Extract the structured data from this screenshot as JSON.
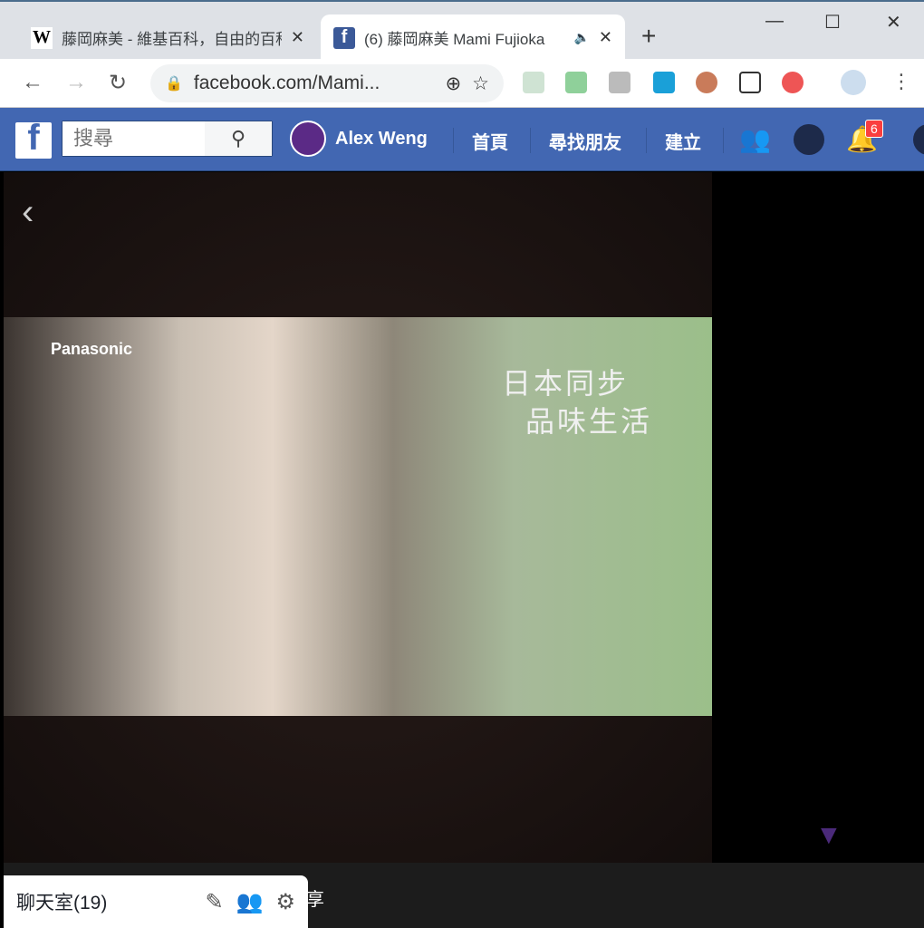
{
  "browser": {
    "tabs": [
      {
        "label": "藤岡麻美 - 維基百科，自由的百科全書",
        "icon": "wikipedia-icon"
      },
      {
        "label": "(6) 藤岡麻美 Mami Fujioka",
        "icon": "facebook-icon",
        "audio": true
      }
    ],
    "url": "facebook.com/Mami...",
    "window_controls": [
      "minimize",
      "maximize",
      "close"
    ]
  },
  "facebook": {
    "search_placeholder": "搜尋",
    "user": "Alex Weng",
    "nav": [
      "首頁",
      "尋找朋友",
      "建立"
    ],
    "notification_count": "6",
    "brand_color": "#4267b2"
  },
  "video": {
    "brand": "Panasonic",
    "slogan_line1": "日本同步",
    "slogan_line2": "品味生活"
  },
  "bottom": {
    "share_fragment": "享"
  },
  "chat": {
    "label": "聊天室(19)"
  }
}
